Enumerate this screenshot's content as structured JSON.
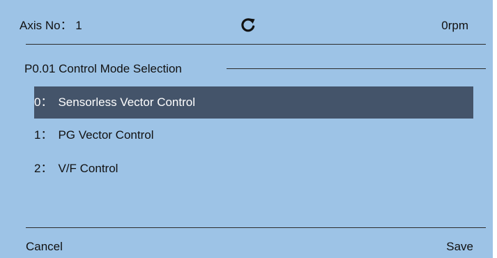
{
  "header": {
    "axis_label": "Axis No：  1",
    "speed": "0rpm",
    "refresh_icon": "refresh-icon"
  },
  "section": {
    "title": "P0.01 Control Mode Selection"
  },
  "options": [
    {
      "index": "0：",
      "label": "Sensorless Vector Control",
      "selected": true
    },
    {
      "index": "1：",
      "label": "PG Vector Control",
      "selected": false
    },
    {
      "index": "2：",
      "label": "V/F Control",
      "selected": false
    }
  ],
  "footer": {
    "cancel_label": "Cancel",
    "save_label": "Save"
  },
  "colors": {
    "background": "#9dc3e6",
    "selected_row": "#44546a",
    "selected_text": "#ffffff",
    "line": "#2b2b2b"
  }
}
